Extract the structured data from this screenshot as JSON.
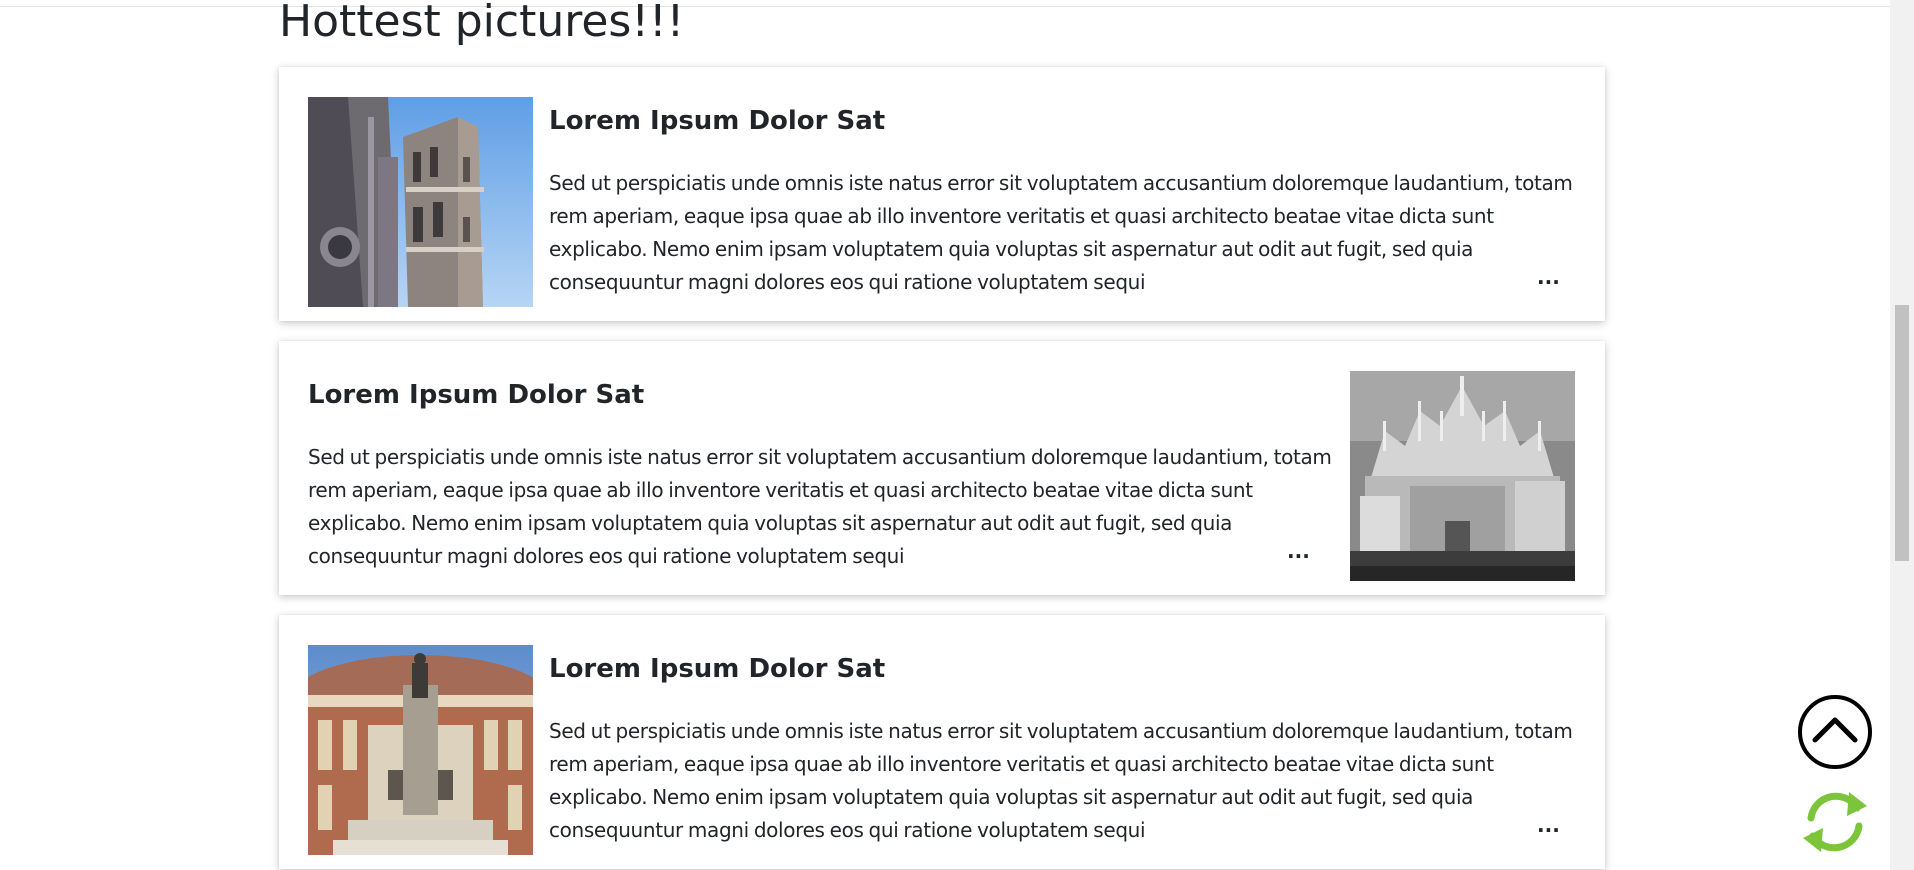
{
  "page": {
    "title": "Hottest pictures!!!"
  },
  "cards": [
    {
      "title": "Lorem Ipsum Dolor Sat",
      "text": "Sed ut perspiciatis unde omnis iste natus error sit voluptatem accusantium doloremque laudantium, totam rem aperiam, eaque ipsa quae ab illo inventore veritatis et quasi architecto beatae vitae dicta sunt explicabo. Nemo enim ipsam voluptatem quia voluptas sit aspernatur aut odit aut fugit, sed quia consequuntur magni dolores eos qui ratione voluptatem sequi",
      "more": "...",
      "image": "florence-cathedral-tower-photo",
      "image_side": "left"
    },
    {
      "title": "Lorem Ipsum Dolor Sat",
      "text": "Sed ut perspiciatis unde omnis iste natus error sit voluptatem accusantium doloremque laudantium, totam rem aperiam, eaque ipsa quae ab illo inventore veritatis et quasi architecto beatae vitae dicta sunt explicabo. Nemo enim ipsam voluptatem quia voluptas sit aspernatur aut odit aut fugit, sed quia consequuntur magni dolores eos qui ratione voluptatem sequi",
      "more": "...",
      "image": "milan-cathedral-grayscale-photo",
      "image_side": "right"
    },
    {
      "title": "Lorem Ipsum Dolor Sat",
      "text": "Sed ut perspiciatis unde omnis iste natus error sit voluptatem accusantium doloremque laudantium, totam rem aperiam, eaque ipsa quae ab illo inventore veritatis et quasi architecto beatae vitae dicta sunt explicabo. Nemo enim ipsam voluptatem quia voluptas sit aspernatur aut odit aut fugit, sed quia consequuntur magni dolores eos qui ratione voluptatem sequi",
      "more": "...",
      "image": "royal-albert-hall-photo",
      "image_side": "left"
    }
  ],
  "controls": {
    "scroll_top_icon": "chevron-up-circle-icon",
    "refresh_icon": "refresh-icon",
    "refresh_color": "#7cc43a"
  }
}
